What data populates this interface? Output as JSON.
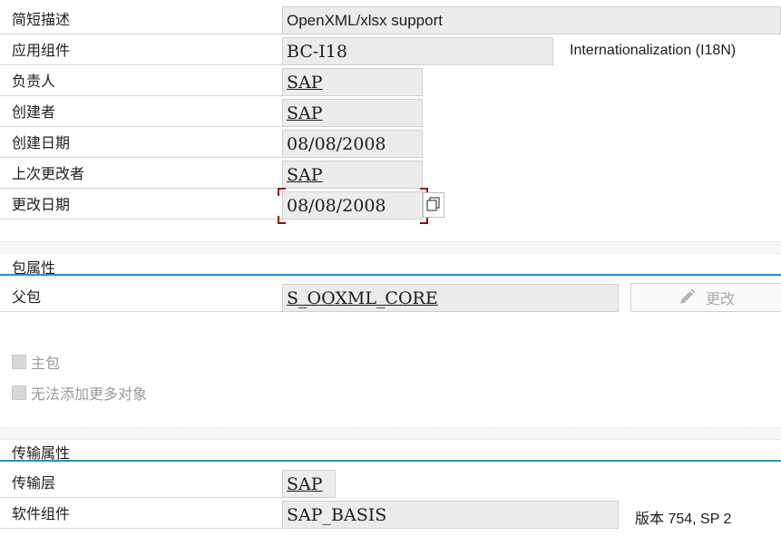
{
  "header": {
    "short_desc_label": "简短描述",
    "short_desc_value": "OpenXML/xlsx support",
    "app_comp_label": "应用组件",
    "app_comp_value": "BC-I18",
    "app_comp_desc": "Internationalization (I18N)",
    "responsible_label": "负责人",
    "responsible_value": "SAP",
    "created_by_label": "创建者",
    "created_by_value": "SAP",
    "created_on_label": "创建日期",
    "created_on_value": "08/08/2008",
    "last_changed_by_label": "上次更改者",
    "last_changed_by_value": "SAP",
    "changed_on_label": "更改日期",
    "changed_on_value": "08/08/2008"
  },
  "package_props": {
    "title": "包属性",
    "parent_label": "父包",
    "parent_value": "S_OOXML_CORE",
    "change_button": "更改",
    "main_package_label": "主包",
    "no_more_objects_label": "无法添加更多对象"
  },
  "transport_props": {
    "title": "传输属性",
    "layer_label": "传输层",
    "layer_value": "SAP",
    "software_comp_label": "软件组件",
    "software_comp_value": "SAP_BASIS",
    "release_prefix": "版本",
    "release_value": "754, SP 2"
  },
  "colors": {
    "section_line": "#2a8fc6",
    "focus_border": "#a4000f",
    "field_bg": "#ececec"
  }
}
